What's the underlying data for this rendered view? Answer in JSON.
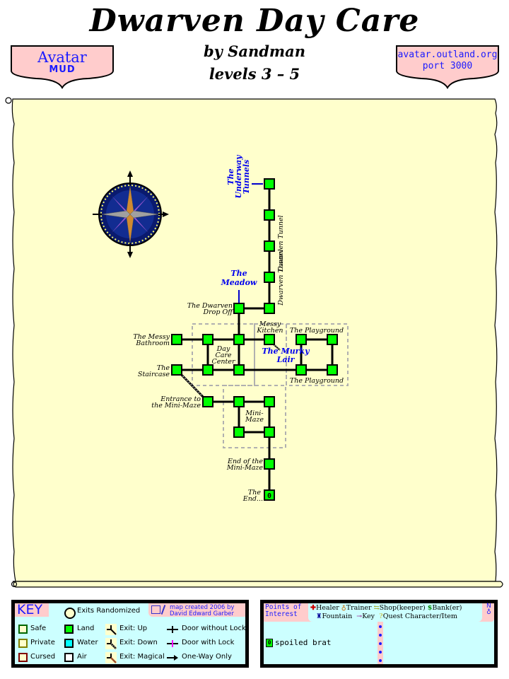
{
  "header": {
    "title": "Dwarven Day Care",
    "author": "by Sandman",
    "levels": "levels 3 – 5"
  },
  "badges": {
    "left": {
      "line1": "Avatar",
      "line2": "MUD"
    },
    "right": {
      "line1": "avatar.outland.org",
      "line2": "port 3000"
    }
  },
  "map": {
    "compass": "compass-rose",
    "rooms": [
      {
        "id": "tunnel-1",
        "label": ""
      },
      {
        "id": "tunnel-2",
        "label": ""
      },
      {
        "id": "tunnel-3",
        "label": ""
      },
      {
        "id": "tunnel-4",
        "label": ""
      },
      {
        "id": "tunnel-5",
        "label": ""
      },
      {
        "id": "drop-off",
        "label": "The Dwarven Drop Off"
      },
      {
        "id": "messy-bathroom",
        "label": "The Messy Bathroom"
      },
      {
        "id": "daycare-nw",
        "label": ""
      },
      {
        "id": "daycare-ne",
        "label": ""
      },
      {
        "id": "messy-kitchen",
        "label": "Messy Kitchen"
      },
      {
        "id": "playground-nw",
        "label": "The Playground"
      },
      {
        "id": "playground-ne",
        "label": ""
      },
      {
        "id": "staircase",
        "label": "The Staircase"
      },
      {
        "id": "daycare-sw",
        "label": ""
      },
      {
        "id": "daycare-se",
        "label": ""
      },
      {
        "id": "playground-sw",
        "label": "The Playground"
      },
      {
        "id": "playground-se",
        "label": ""
      },
      {
        "id": "maze-entrance",
        "label": "Entrance to the Mini-Maze"
      },
      {
        "id": "maze-nw",
        "label": ""
      },
      {
        "id": "maze-ne",
        "label": ""
      },
      {
        "id": "maze-sw",
        "label": ""
      },
      {
        "id": "maze-se",
        "label": ""
      },
      {
        "id": "maze-end",
        "label": "End of the Mini-Maze"
      },
      {
        "id": "the-end",
        "label": "The End...",
        "marker": "0"
      }
    ],
    "labels": {
      "underway_1": "The",
      "underway_2": "Underway",
      "underway_3": "Tunnels",
      "meadow_1": "The",
      "meadow_2": "Meadow",
      "murky_1": "The Murky",
      "murky_2": "Lair",
      "tunnel_a": "Dwarven Tunnel",
      "tunnel_b": "Dwarven Tunnel",
      "dropoff_1": "The Dwarven",
      "dropoff_2": "Drop Off",
      "bathroom_1": "The Messy",
      "bathroom_2": "Bathroom",
      "kitchen_1": "Messy",
      "kitchen_2": "Kitchen",
      "playground_top": "The Playground",
      "playground_bottom": "The Playground",
      "daycare_1": "Day",
      "daycare_2": "Care",
      "daycare_3": "Center",
      "staircase_1": "The",
      "staircase_2": "Staircase",
      "entrance_1": "Entrance to",
      "entrance_2": "the Mini-Maze",
      "minimaze_1": "Mini-",
      "minimaze_2": "Maze",
      "mazeend_1": "End of the",
      "mazeend_2": "Mini-Maze",
      "theend_1": "The",
      "theend_2": "End...",
      "theend_marker": "0"
    }
  },
  "key": {
    "title": "KEY",
    "exits_randomized": "Exits Randomized",
    "credit_1": "map created 2006 by",
    "credit_2": "David Edward Garber",
    "items": {
      "safe": "Safe",
      "private": "Private",
      "cursed": "Cursed",
      "land": "Land",
      "water": "Water",
      "air": "Air",
      "exit_up": "Exit: Up",
      "exit_down": "Exit: Down",
      "exit_magical": "Exit: Magical",
      "door_no_lock": "Door without Lock",
      "door_lock": "Door with Lock",
      "one_way": "One-Way Only"
    },
    "colors": {
      "safe": "#006600",
      "private": "#808000",
      "cursed": "#800000",
      "land": "#00ff00",
      "water": "#00ffff",
      "air": "#ffffff",
      "lock": "#ff00ff"
    }
  },
  "poi": {
    "title_1": "Points of",
    "title_2": "Interest",
    "legend": {
      "healer": "Healer",
      "trainer": "Trainer",
      "shop": "Shop(keeper)",
      "bank": "Bank(er)",
      "fountain": "Fountain",
      "key": "Key",
      "quest": "Quest Character/Item"
    },
    "north": "N",
    "entries": [
      {
        "marker": "0",
        "text": "spoiled brat"
      }
    ]
  },
  "colors": {
    "parchment": "#ffffcc",
    "room": "#00ff00",
    "link_label": "#0000ff",
    "badge_fill": "#ffcccc",
    "panel": "#ccffff"
  }
}
